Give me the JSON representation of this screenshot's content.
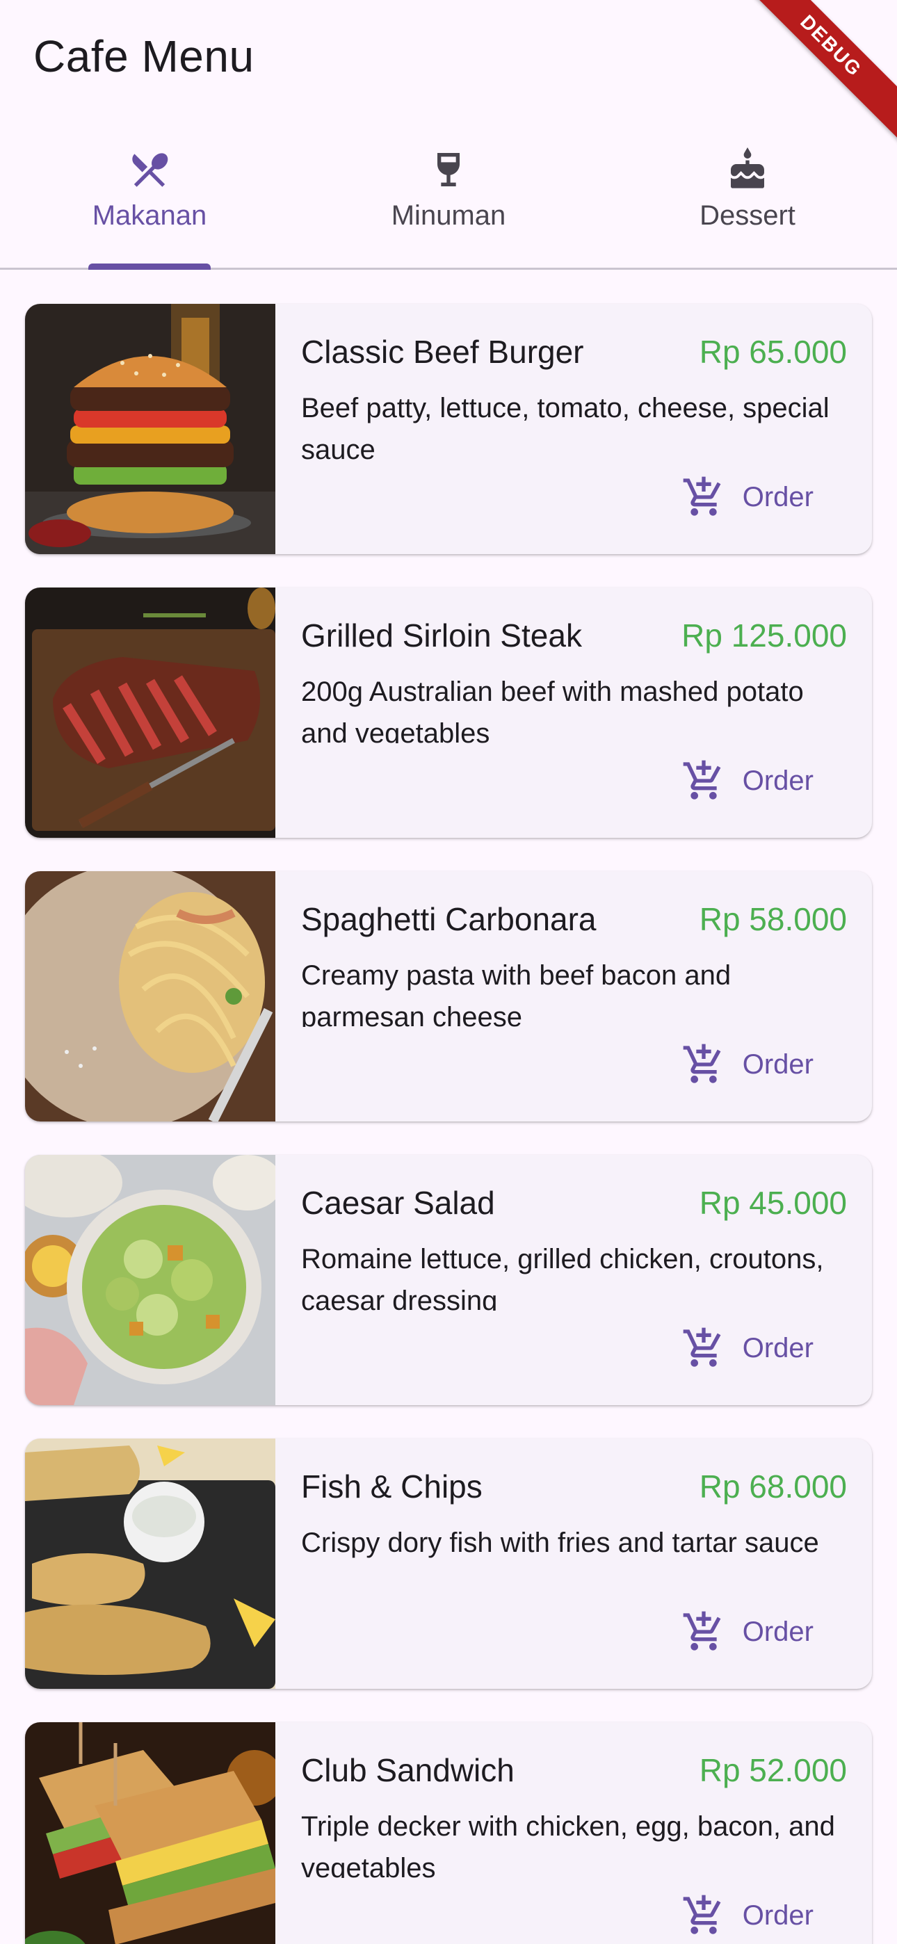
{
  "app": {
    "title": "Cafe Menu",
    "debug_banner": "DEBUG"
  },
  "tabs": [
    {
      "label": "Makanan",
      "icon": "restaurant-icon",
      "active": true
    },
    {
      "label": "Minuman",
      "icon": "wine-glass-icon",
      "active": false
    },
    {
      "label": "Dessert",
      "icon": "cake-icon",
      "active": false
    }
  ],
  "menu": [
    {
      "name": "Classic Beef Burger",
      "price": "Rp 65.000",
      "description": "Beef patty, lettuce, tomato, cheese, special sauce",
      "image": "burger-photo",
      "order_label": "Order"
    },
    {
      "name": "Grilled Sirloin Steak",
      "price": "Rp 125.000",
      "description": "200g Australian beef with mashed potato and vegetables",
      "image": "steak-photo",
      "order_label": "Order"
    },
    {
      "name": "Spaghetti Carbonara",
      "price": "Rp 58.000",
      "description": "Creamy pasta with beef bacon and parmesan cheese",
      "image": "pasta-photo",
      "order_label": "Order"
    },
    {
      "name": "Caesar Salad",
      "price": "Rp 45.000",
      "description": "Romaine lettuce, grilled chicken, croutons, caesar dressing",
      "image": "salad-photo",
      "order_label": "Order"
    },
    {
      "name": "Fish & Chips",
      "price": "Rp 68.000",
      "description": "Crispy dory fish with fries and tartar sauce",
      "image": "fish-chips-photo",
      "order_label": "Order"
    },
    {
      "name": "Club Sandwich",
      "price": "Rp 52.000",
      "description": "Triple decker with chicken, egg, bacon, and vegetables",
      "image": "sandwich-photo",
      "order_label": "Order"
    }
  ],
  "colors": {
    "primary": "#6750a4",
    "price": "#4caf50",
    "surface": "#f7f2fa",
    "background": "#fef7ff",
    "debug": "#b71c1c"
  }
}
